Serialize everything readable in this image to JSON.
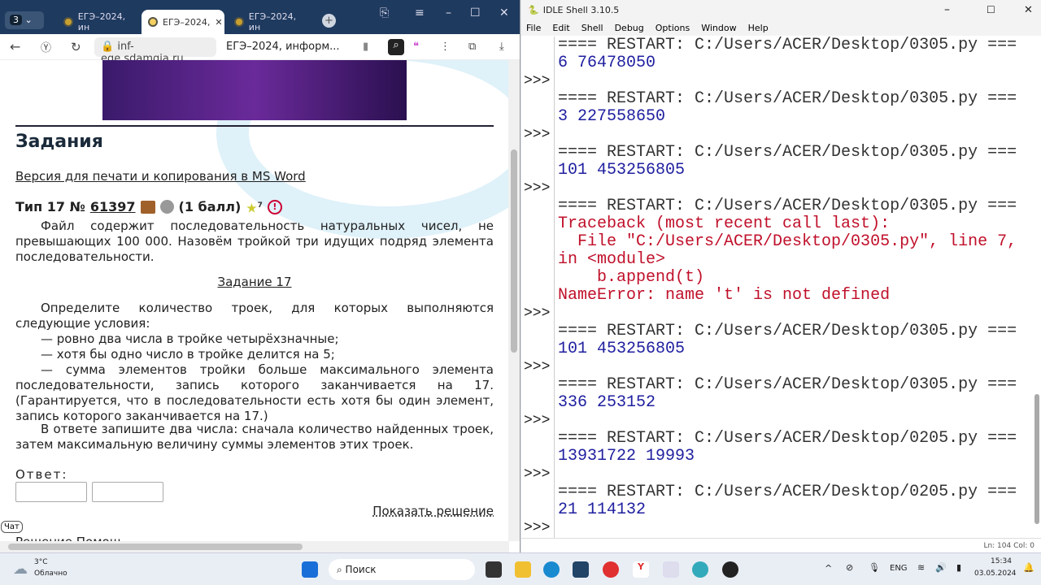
{
  "browser": {
    "tab_count": "3",
    "tabs": [
      "ЕГЭ–2024, ин",
      "ЕГЭ–2024,",
      "ЕГЭ–2024, ин"
    ],
    "url": "inf-ege.sdamgia.ru",
    "page_title": "ЕГЭ–2024, информ...",
    "heading": "Задания",
    "print_link": "Версия для печати и копирования в MS Word",
    "task_type": "Тип 17 №",
    "task_number": "61397",
    "points": "(1 балл)",
    "star_count": "7",
    "intro": "Файл содержит последовательность натуральных чисел, не превышающих 100 000. Назовём тройкой три идущих подряд элемента последовательности.",
    "task_link": "Задание 17",
    "body": [
      "Определите количество троек, для которых выполняются следующие условия:",
      "— ровно два числа в тройке четырёхзначные;",
      "— хотя бы одно число в тройке делится на 5;",
      "— сумма элементов тройки больше максимального элемента последовательности, запись которого заканчивается на 17. (Гарантируется, что в последовательности есть хотя бы один элемент, запись которого заканчивается на 17.)",
      "В ответе запишите два числа: сначала количество найденных троек, затем максимальную величину суммы элементов этих троек."
    ],
    "answer_label": "Ответ:",
    "show_solution": "Показать решение",
    "chat": "Чат",
    "cut_text": "Решение   Помощ"
  },
  "idle": {
    "title": "IDLE Shell 3.10.5",
    "menu": [
      "File",
      "Edit",
      "Shell",
      "Debug",
      "Options",
      "Window",
      "Help"
    ],
    "lines": [
      {
        "p": "",
        "t": "==== RESTART: C:/Users/ACER/Desktop/0305.py ===",
        "c": "restart"
      },
      {
        "p": "",
        "t": "6 76478050",
        "c": "out"
      },
      {
        "p": ">>>",
        "t": "",
        "c": "out"
      },
      {
        "p": "",
        "t": "==== RESTART: C:/Users/ACER/Desktop/0305.py ===",
        "c": "restart"
      },
      {
        "p": "",
        "t": "3 227558650",
        "c": "out"
      },
      {
        "p": ">>>",
        "t": "",
        "c": "out"
      },
      {
        "p": "",
        "t": "==== RESTART: C:/Users/ACER/Desktop/0305.py ===",
        "c": "restart"
      },
      {
        "p": "",
        "t": "101 453256805",
        "c": "out"
      },
      {
        "p": ">>>",
        "t": "",
        "c": "out"
      },
      {
        "p": "",
        "t": "==== RESTART: C:/Users/ACER/Desktop/0305.py ===",
        "c": "restart"
      },
      {
        "p": "",
        "t": "Traceback (most recent call last):",
        "c": "err"
      },
      {
        "p": "",
        "t": "  File \"C:/Users/ACER/Desktop/0305.py\", line 7,",
        "c": "err"
      },
      {
        "p": "",
        "t": "in <module>",
        "c": "err"
      },
      {
        "p": "",
        "t": "    b.append(t)",
        "c": "err"
      },
      {
        "p": "",
        "t": "NameError: name 't' is not defined",
        "c": "err"
      },
      {
        "p": ">>>",
        "t": "",
        "c": "out"
      },
      {
        "p": "",
        "t": "==== RESTART: C:/Users/ACER/Desktop/0305.py ===",
        "c": "restart"
      },
      {
        "p": "",
        "t": "101 453256805",
        "c": "out"
      },
      {
        "p": ">>>",
        "t": "",
        "c": "out"
      },
      {
        "p": "",
        "t": "==== RESTART: C:/Users/ACER/Desktop/0305.py ===",
        "c": "restart"
      },
      {
        "p": "",
        "t": "336 253152",
        "c": "out"
      },
      {
        "p": ">>>",
        "t": "",
        "c": "out"
      },
      {
        "p": "",
        "t": "==== RESTART: C:/Users/ACER/Desktop/0205.py ===",
        "c": "restart"
      },
      {
        "p": "",
        "t": "13931722 19993",
        "c": "out"
      },
      {
        "p": ">>>",
        "t": "",
        "c": "out"
      },
      {
        "p": "",
        "t": "==== RESTART: C:/Users/ACER/Desktop/0205.py ===",
        "c": "restart"
      },
      {
        "p": "",
        "t": "21 114132",
        "c": "out"
      },
      {
        "p": ">>>",
        "t": "",
        "c": "out"
      }
    ],
    "status": "Ln: 104  Col: 0"
  },
  "taskbar": {
    "temp": "3°C",
    "weather": "Облачно",
    "search": "Поиск",
    "lang": "ENG",
    "time": "15:34",
    "date": "03.05.2024"
  }
}
